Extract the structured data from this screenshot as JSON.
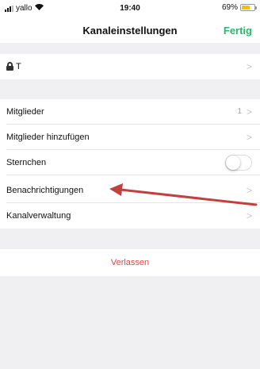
{
  "status_bar": {
    "carrier": "yallo",
    "wifi_icon": "wifi-icon",
    "time": "19:40",
    "battery_percent": "69%",
    "battery_level": 0.69,
    "battery_color": "#f2c200"
  },
  "nav": {
    "title": "Kanaleinstellungen",
    "done_label": "Fertig",
    "accent_color": "#2fb56a"
  },
  "channel": {
    "lock_icon": "lock-icon",
    "name": "T"
  },
  "settings": {
    "members_label": "Mitglieder",
    "members_count": "1",
    "add_members_label": "Mitglieder hinzufügen",
    "starred_label": "Sternchen",
    "starred_on": false,
    "notifications_label": "Benachrichtigungen",
    "channel_admin_label": "Kanalverwaltung"
  },
  "actions": {
    "leave_label": "Verlassen",
    "leave_color": "#e34545"
  },
  "annotation": {
    "arrow_color": "#c0413f",
    "points_to": "notifications-cell"
  }
}
